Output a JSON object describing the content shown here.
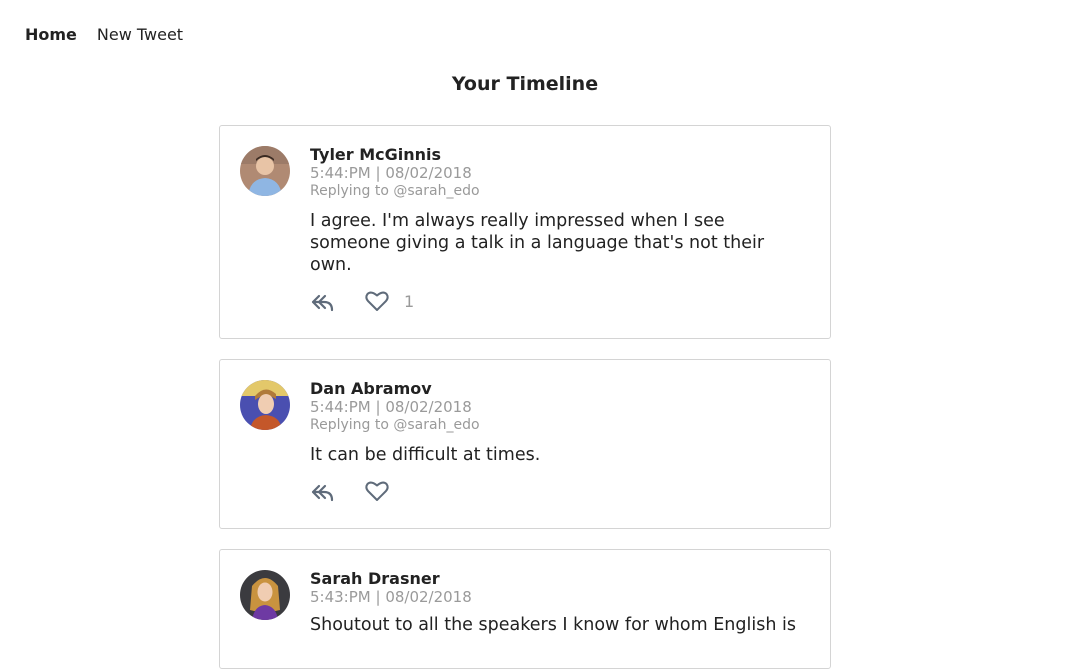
{
  "nav": {
    "home_label": "Home",
    "new_tweet_label": "New Tweet"
  },
  "page": {
    "title": "Your Timeline"
  },
  "tweets": [
    {
      "author": "Tyler McGinnis",
      "timestamp": "5:44:PM | 08/02/2018",
      "replying_to": "Replying to @sarah_edo",
      "text": "I agree. I'm always really impressed when I see someone giving a talk in a language that's not their own.",
      "like_count": "1",
      "avatar_icon": "avatar-tyler"
    },
    {
      "author": "Dan Abramov",
      "timestamp": "5:44:PM | 08/02/2018",
      "replying_to": "Replying to @sarah_edo",
      "text": "It can be difficult at times.",
      "like_count": "",
      "avatar_icon": "avatar-dan"
    },
    {
      "author": "Sarah Drasner",
      "timestamp": "5:43:PM | 08/02/2018",
      "replying_to": "",
      "text": "Shoutout to all the speakers I know for whom English is",
      "like_count": "",
      "avatar_icon": "avatar-sarah"
    }
  ],
  "colors": {
    "icon_stroke": "#5f6b7a",
    "muted_text": "#9a9a9a",
    "card_border": "#d4d4d4"
  }
}
